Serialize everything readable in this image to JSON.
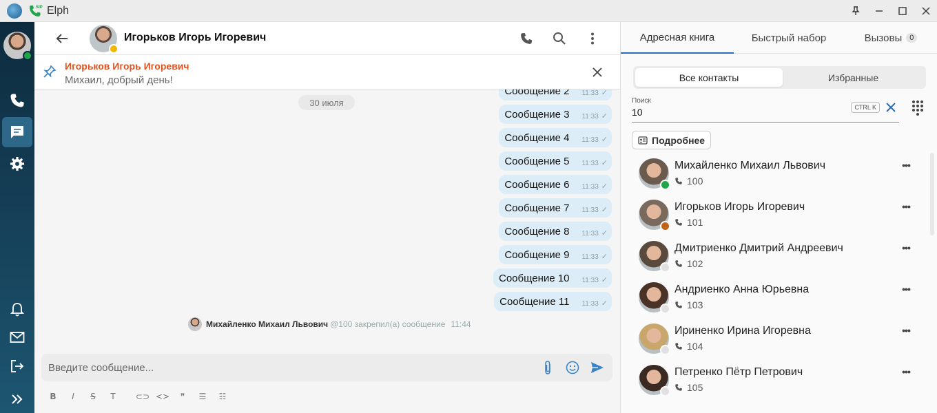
{
  "app": {
    "title": "Elph",
    "sip_label": "SIP"
  },
  "window_controls": [
    "pin-icon",
    "minimize-icon",
    "maximize-icon",
    "close-icon"
  ],
  "rail": {
    "items": [
      {
        "name": "calls",
        "icon": "phone-icon"
      },
      {
        "name": "chats",
        "icon": "chat-icon",
        "active": true
      },
      {
        "name": "settings",
        "icon": "gear-icon"
      },
      {
        "name": "notifications",
        "icon": "bell-icon"
      },
      {
        "name": "mail",
        "icon": "mail-icon"
      },
      {
        "name": "logout",
        "icon": "logout-icon"
      },
      {
        "name": "expand",
        "icon": "chevrons-right-icon"
      }
    ]
  },
  "chat": {
    "contact_name": "Игорьков Игорь Игоревич",
    "pinned": {
      "author": "Игорьков Игорь Игоревич",
      "text": "Михаил, добрый день!"
    },
    "date_label": "30 июля",
    "messages": [
      {
        "text": "Сообщение 2",
        "time": "11:33"
      },
      {
        "text": "Сообщение 3",
        "time": "11:33"
      },
      {
        "text": "Сообщение 4",
        "time": "11:33"
      },
      {
        "text": "Сообщение 5",
        "time": "11:33"
      },
      {
        "text": "Сообщение 6",
        "time": "11:33"
      },
      {
        "text": "Сообщение 7",
        "time": "11:33"
      },
      {
        "text": "Сообщение 8",
        "time": "11:33"
      },
      {
        "text": "Сообщение 9",
        "time": "11:33"
      },
      {
        "text": "Сообщение 10",
        "time": "11:33"
      },
      {
        "text": "Сообщение 11",
        "time": "11:33"
      }
    ],
    "system_message": {
      "name": "Михайленко Михаил Львович",
      "text": "@100 закрепил(а) сообщение",
      "time": "11:44"
    },
    "composer": {
      "placeholder": "Введите сообщение...",
      "value": ""
    },
    "format_tools": [
      {
        "name": "bold-icon",
        "glyph": "B"
      },
      {
        "name": "italic-icon",
        "glyph": "I"
      },
      {
        "name": "strikethrough-icon",
        "glyph": "S"
      },
      {
        "name": "text-icon",
        "glyph": "T"
      },
      {
        "name": "link-icon",
        "glyph": "⊂⊃"
      },
      {
        "name": "code-icon",
        "glyph": "<>"
      },
      {
        "name": "quote-icon",
        "glyph": "❞"
      },
      {
        "name": "bullet-list-icon",
        "glyph": "☰"
      },
      {
        "name": "numbered-list-icon",
        "glyph": "☷"
      }
    ]
  },
  "right": {
    "tabs": [
      {
        "label": "Адресная книга",
        "active": true
      },
      {
        "label": "Быстрый набор"
      },
      {
        "label": "Вызовы",
        "count": "0"
      }
    ],
    "segments": [
      {
        "label": "Все контакты",
        "active": true
      },
      {
        "label": "Избранные"
      }
    ],
    "search": {
      "label": "Поиск",
      "value": "10",
      "shortcut": "CTRL K"
    },
    "more_button": "Подробнее",
    "contacts": [
      {
        "name": "Михайленко Михаил Львович",
        "phone": "100",
        "status": "available",
        "status_color": "#1fa64a",
        "avatar_color": "#6b5a4e"
      },
      {
        "name": "Игорьков Игорь Игоревич",
        "phone": "101",
        "status": "away",
        "status_color": "#c0641a",
        "avatar_color": "#7a6a5e"
      },
      {
        "name": "Дмитриенко Дмитрий Андреевич",
        "phone": "102",
        "status": "offline",
        "status_color": "#e0e0e0",
        "avatar_color": "#5a4a3e"
      },
      {
        "name": "Андриенко Анна Юрьевна",
        "phone": "103",
        "status": "offline",
        "status_color": "#e0e0e0",
        "avatar_color": "#4a3226"
      },
      {
        "name": "Ириненко Ирина Игоревна",
        "phone": "104",
        "status": "offline",
        "status_color": "#e0e0e0",
        "avatar_color": "#c9a66b"
      },
      {
        "name": "Петренко Пётр Петрович",
        "phone": "105",
        "status": "offline",
        "status_color": "#e0e0e0",
        "avatar_color": "#3a2a22"
      }
    ]
  },
  "colors": {
    "accent": "#2a6db5",
    "pinned_author": "#e0531f",
    "bubble": "#dcedf8",
    "rail": "#0d2b3e"
  }
}
